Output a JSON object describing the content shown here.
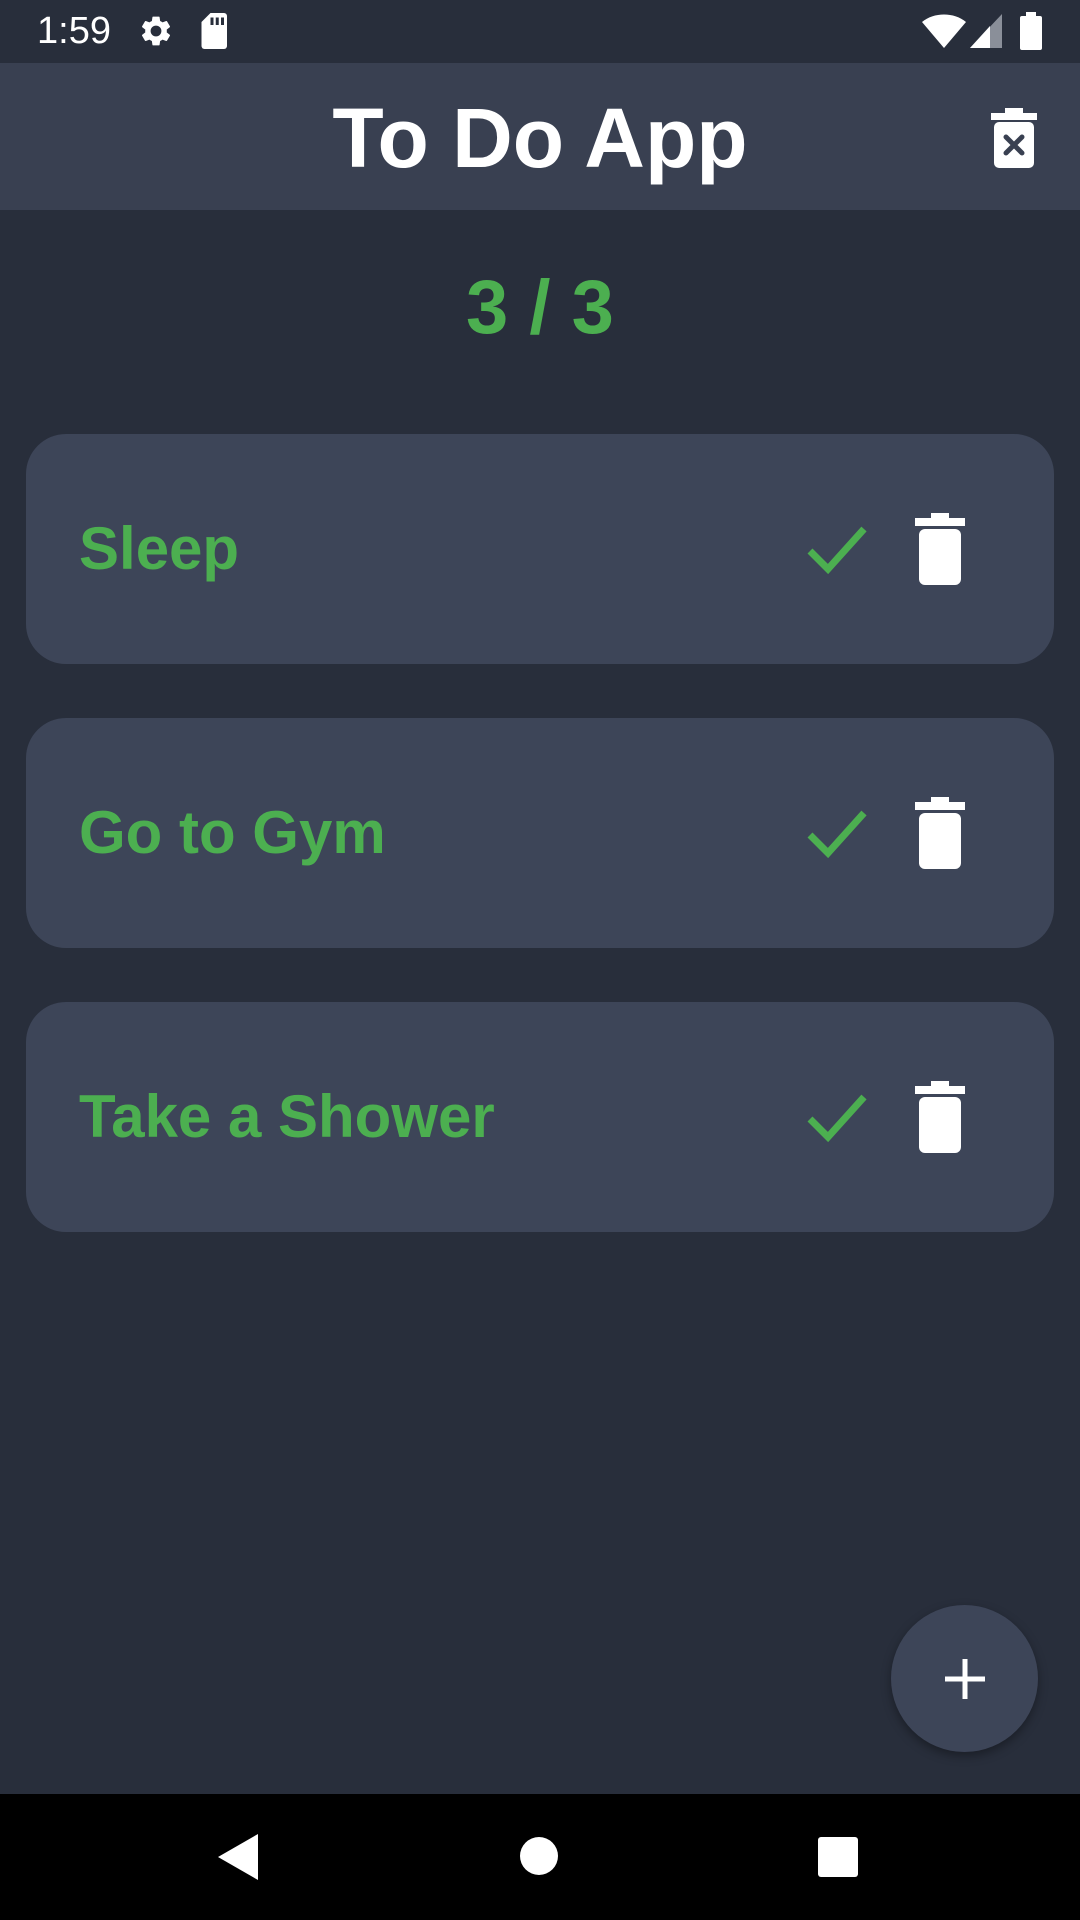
{
  "status_bar": {
    "time": "1:59",
    "icons": [
      "settings-icon",
      "sd-card-icon",
      "wifi-icon",
      "cell-signal-icon",
      "battery-icon"
    ]
  },
  "app_bar": {
    "title": "To Do App",
    "clear_all_icon": "delete-forever-icon"
  },
  "counter": {
    "text": "3 / 3"
  },
  "tasks": [
    {
      "title": "Sleep",
      "done": true
    },
    {
      "title": "Go to Gym",
      "done": true
    },
    {
      "title": "Take a Shower",
      "done": true
    }
  ],
  "fab": {
    "icon": "plus-icon"
  },
  "nav_bar": {
    "icons": [
      "back-icon",
      "home-icon",
      "recents-icon"
    ]
  },
  "colors": {
    "background": "#282e3b",
    "app_bar": "#394051",
    "card": "#3d4558",
    "accent_green": "#4caf50",
    "text_white": "#ffffff"
  }
}
